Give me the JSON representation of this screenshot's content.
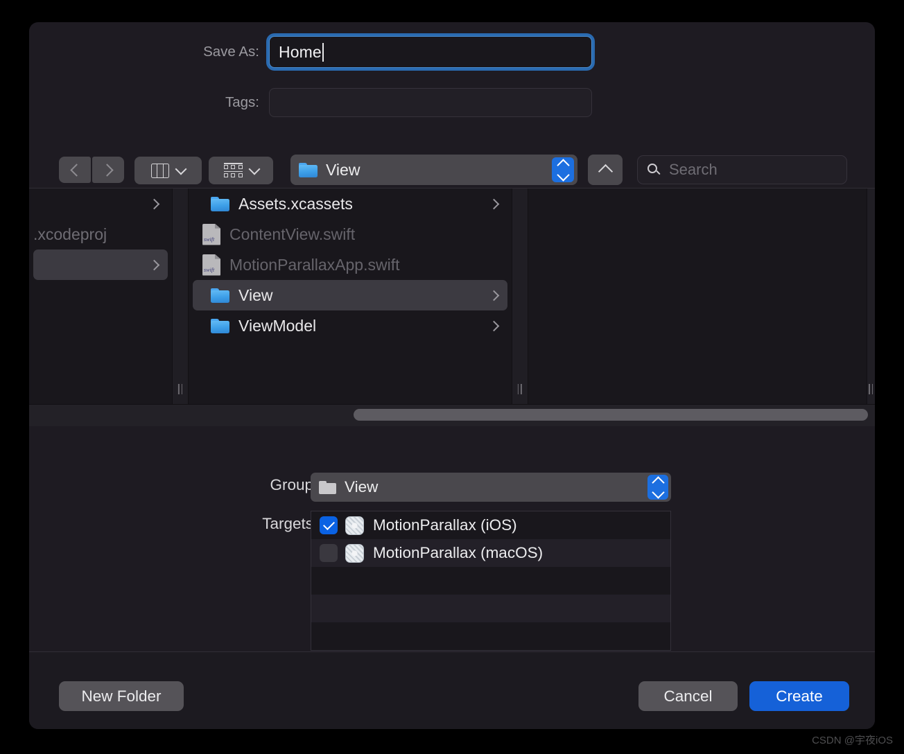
{
  "dialog": {
    "save_as_label": "Save As:",
    "save_as_value": "Home",
    "tags_label": "Tags:",
    "tags_value": ""
  },
  "toolbar": {
    "back_icon": "chevron-left-icon",
    "forward_icon": "chevron-right-icon",
    "view_mode_icon": "column-view-icon",
    "group_mode_icon": "group-by-icon",
    "path_popup_value": "View",
    "path_popup_icon": "blue-folder-icon",
    "up_icon": "chevron-up-icon",
    "search_placeholder": "Search",
    "search_icon": "search-icon"
  },
  "browser": {
    "column1": [
      {
        "name": "",
        "type": "folder",
        "dim": true,
        "selected": false,
        "chevron": true
      },
      {
        "name": ".xcodeproj",
        "type": "text",
        "dim": true,
        "selected": false,
        "chevron": false
      },
      {
        "name": "",
        "type": "folder",
        "dim": true,
        "selected": true,
        "chevron": true
      }
    ],
    "column2": [
      {
        "name": "Assets.xcassets",
        "type": "folder",
        "dim": false,
        "selected": false,
        "chevron": true
      },
      {
        "name": "ContentView.swift",
        "type": "swift",
        "dim": true,
        "selected": false,
        "chevron": false
      },
      {
        "name": "MotionParallaxApp.swift",
        "type": "swift",
        "dim": true,
        "selected": false,
        "chevron": false
      },
      {
        "name": "View",
        "type": "folder",
        "dim": false,
        "selected": true,
        "chevron": true
      },
      {
        "name": "ViewModel",
        "type": "folder",
        "dim": false,
        "selected": false,
        "chevron": true
      }
    ],
    "column3": []
  },
  "accessory": {
    "group_label": "Group",
    "group_value": "View",
    "group_icon": "folder-icon",
    "targets_label": "Targets",
    "targets": [
      {
        "name": "MotionParallax (iOS)",
        "checked": true
      },
      {
        "name": "MotionParallax (macOS)",
        "checked": false
      }
    ]
  },
  "buttons": {
    "new_folder": "New Folder",
    "cancel": "Cancel",
    "create": "Create"
  },
  "watermark": "CSDN @宇夜iOS",
  "colors": {
    "accent_blue": "#1561d8",
    "focus_ring": "#2a6ab0",
    "dialog_bg": "#1e1b22",
    "column_bg": "#19171c",
    "selected_row": "#3c3a41",
    "checkbox_on": "#0a62e3"
  }
}
